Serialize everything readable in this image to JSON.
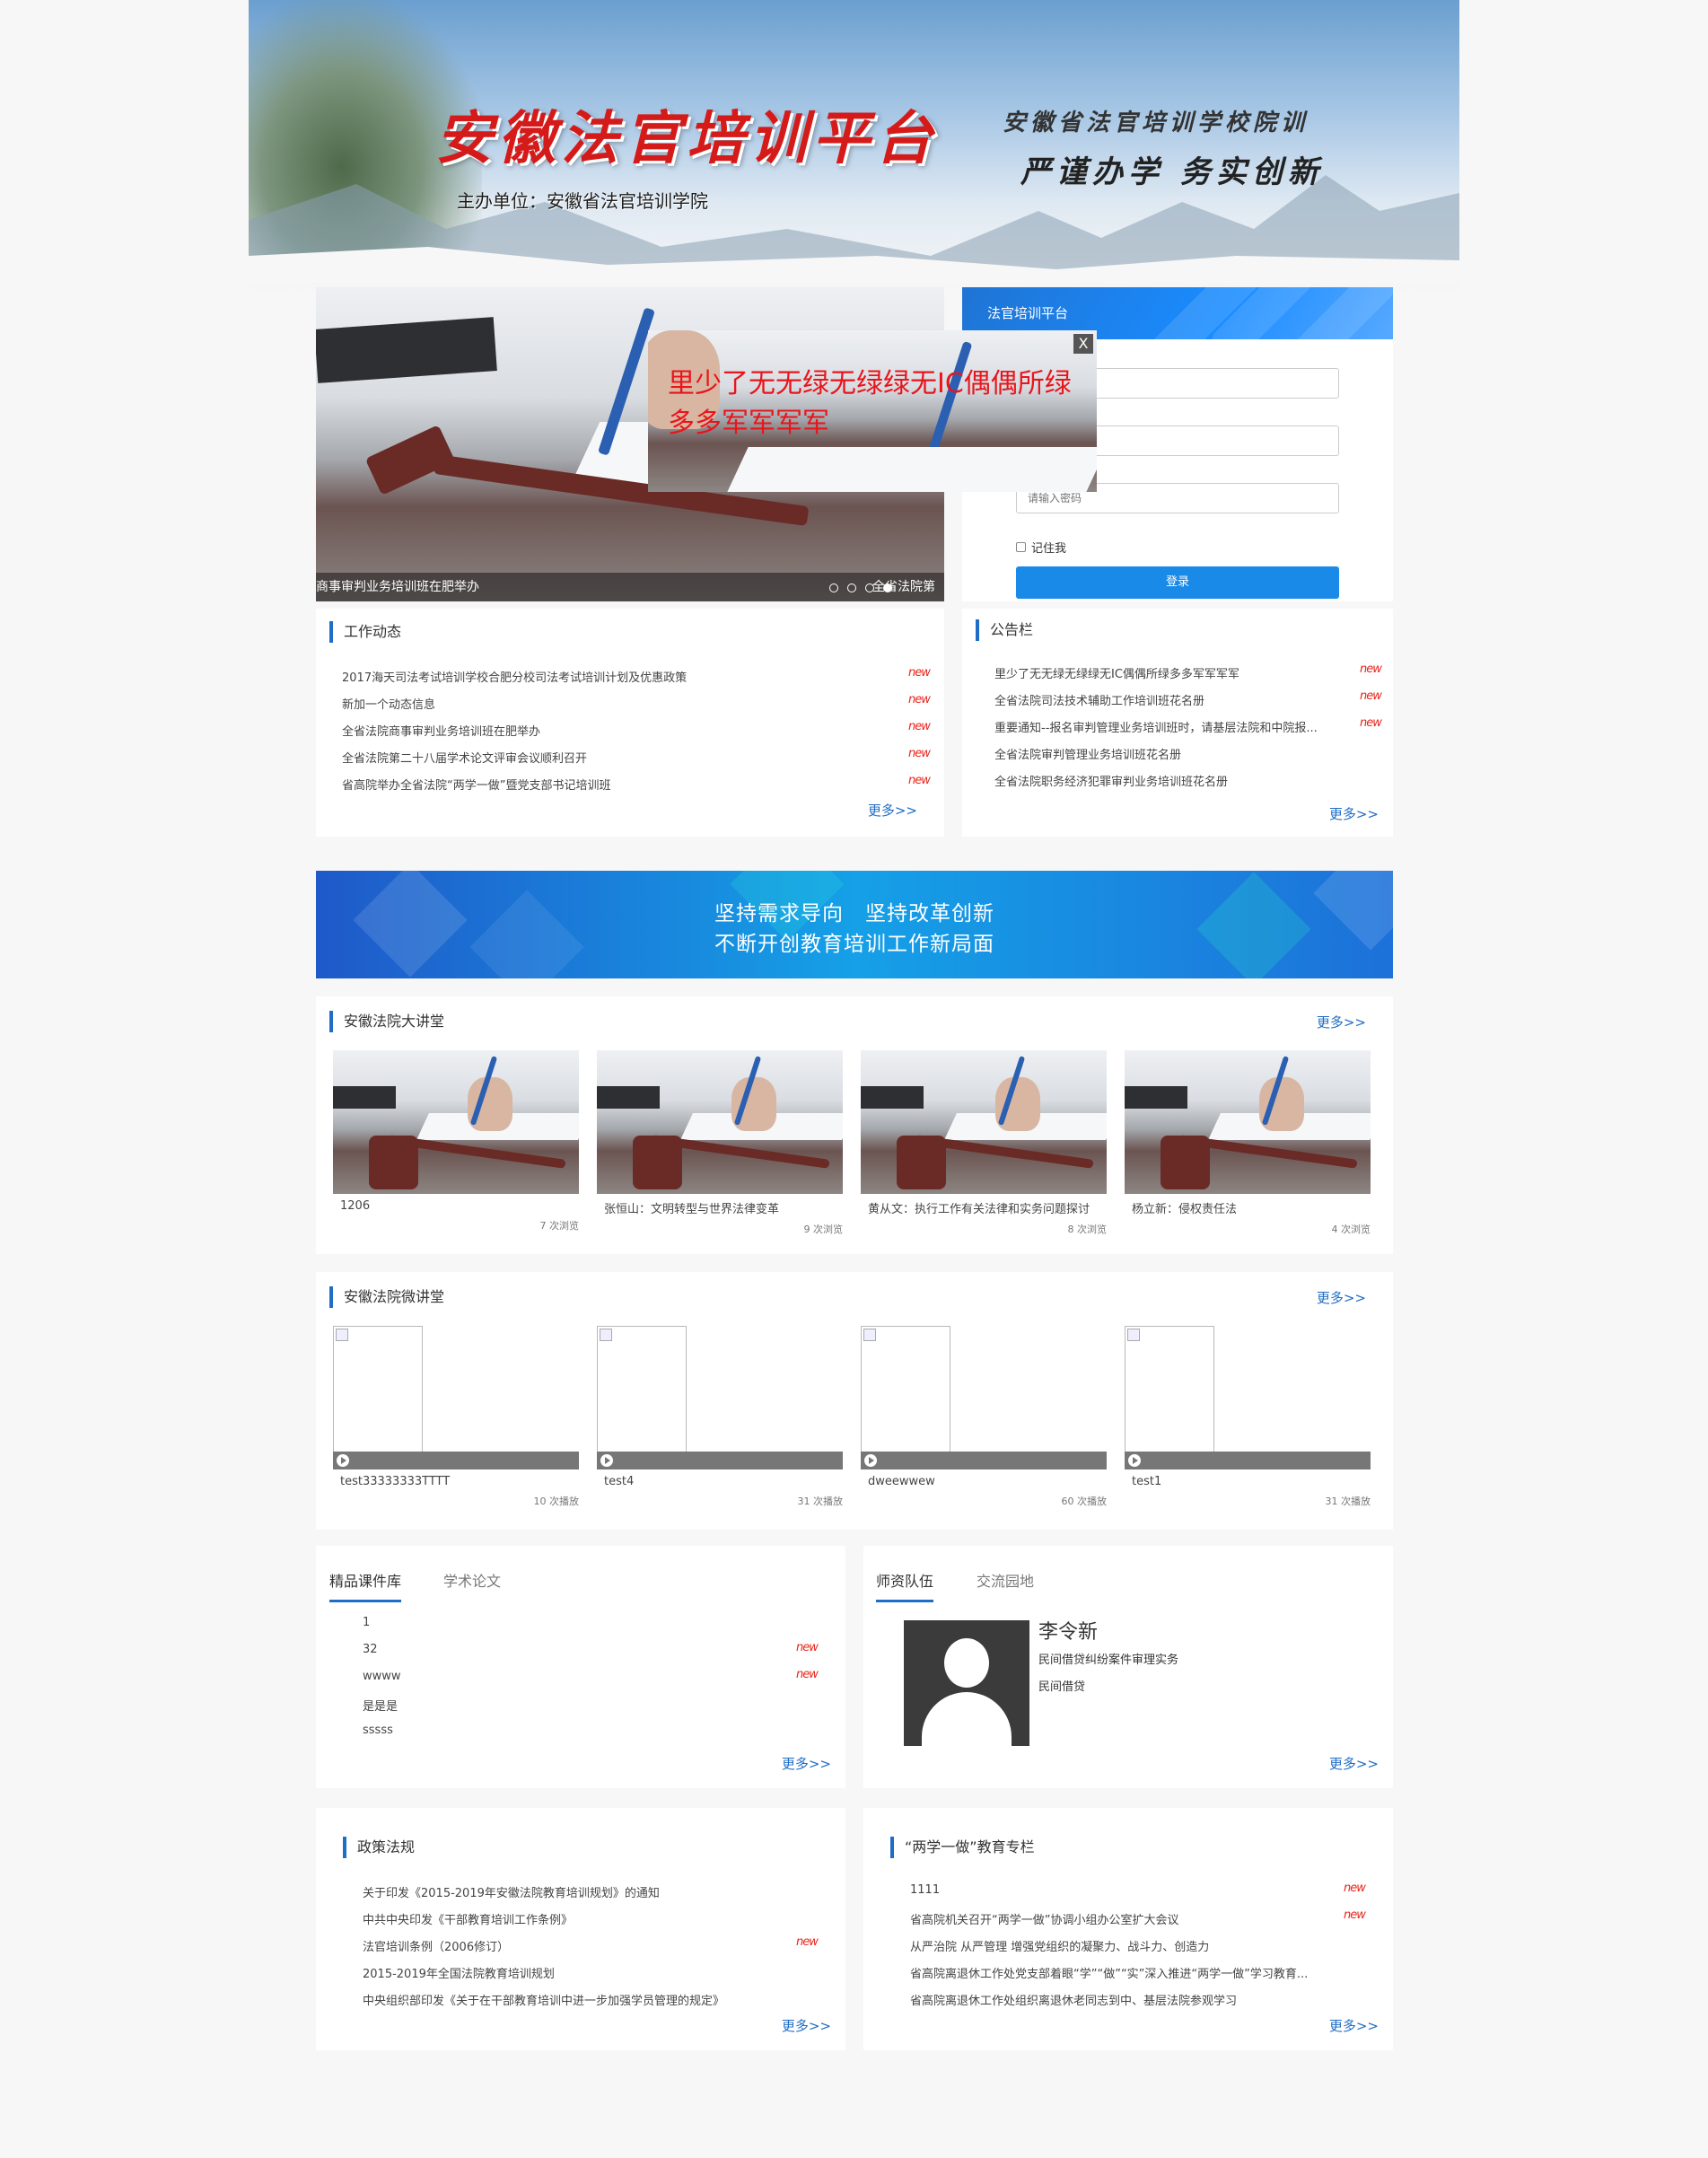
{
  "header": {
    "site_title": "安徽法官培训平台",
    "sponsor": "主办单位：安徽省法官培训学院",
    "slogan_line1": "安徽省法官培训学校院训",
    "slogan_line2": "严谨办学 务实创新"
  },
  "slider": {
    "caption": "商事审判业务培训班在肥举办",
    "caption_right": "全省法院第",
    "dots": 4
  },
  "popup": {
    "text": "里少了无无绿无绿绿无IC偶偶所绿多多军军军军",
    "close_label": "X"
  },
  "login": {
    "title": "法官培训平台",
    "username_placeholder": "",
    "password_placeholder_partial": "码",
    "password_placeholder": "请输入密码",
    "remember_label": "记住我",
    "login_button": "登录"
  },
  "work_news": {
    "title": "工作动态",
    "items": [
      {
        "text": "2017海天司法考试培训学校合肥分校司法考试培训计划及优惠政策",
        "new": true
      },
      {
        "text": "新加一个动态信息",
        "new": true
      },
      {
        "text": "全省法院商事审判业务培训班在肥举办",
        "new": true
      },
      {
        "text": "全省法院第二十八届学术论文评审会议顺利召开",
        "new": true
      },
      {
        "text": "省高院举办全省法院“两学一做”暨党支部书记培训班",
        "new": true
      }
    ],
    "more": "更多>>"
  },
  "notice": {
    "title": "公告栏",
    "items": [
      {
        "text": "里少了无无绿无绿绿无IC偶偶所绿多多军军军军",
        "new": true
      },
      {
        "text": "全省法院司法技术辅助工作培训班花名册",
        "new": true
      },
      {
        "text": "重要通知--报名审判管理业务培训班时，请基层法院和中院报...",
        "new": true
      },
      {
        "text": "全省法院审判管理业务培训班花名册",
        "new": false
      },
      {
        "text": "全省法院职务经济犯罪审判业务培训班花名册",
        "new": false
      }
    ],
    "more": "更多>>"
  },
  "new_label": "new",
  "banner": {
    "line1": "坚持需求导向　坚持改革创新",
    "line2": "不断开创教育培训工作新局面"
  },
  "lecture_hall": {
    "title": "安徽法院大讲堂",
    "more": "更多>>",
    "items": [
      {
        "title": "1206",
        "views": "7 次浏览"
      },
      {
        "title": "张恒山：文明转型与世界法律变革",
        "views": "9 次浏览"
      },
      {
        "title": "黄从文：执行工作有关法律和实务问题探讨",
        "views": "8 次浏览"
      },
      {
        "title": "杨立新：侵权责任法",
        "views": "4 次浏览"
      }
    ]
  },
  "micro_lecture": {
    "title": "安徽法院微讲堂",
    "more": "更多>>",
    "items": [
      {
        "title": "test33333333TTTT",
        "plays": "10 次播放"
      },
      {
        "title": "test4",
        "plays": "31 次播放"
      },
      {
        "title": "dweewwew",
        "plays": "60 次播放"
      },
      {
        "title": "test1",
        "plays": "31 次播放"
      }
    ]
  },
  "courseware": {
    "tabs": [
      "精品课件库",
      "学术论文"
    ],
    "items": [
      {
        "text": "1",
        "new": false
      },
      {
        "text": "32",
        "new": true
      },
      {
        "text": "wwww",
        "new": true
      },
      {
        "text": "是是是",
        "new": false
      },
      {
        "text": "sssss",
        "new": false
      }
    ],
    "more": "更多>>"
  },
  "faculty": {
    "tabs": [
      "师资队伍",
      "交流园地"
    ],
    "teacher_name": "李令新",
    "teacher_line1": "民间借贷纠纷案件审理实务",
    "teacher_line2": "民间借贷",
    "more": "更多>>"
  },
  "policy": {
    "title": "政策法规",
    "items": [
      {
        "text": "关于印发《2015-2019年安徽法院教育培训规划》的通知",
        "new": false
      },
      {
        "text": "中共中央印发《干部教育培训工作条例》",
        "new": false
      },
      {
        "text": "法官培训条例（2006修订）",
        "new": true
      },
      {
        "text": "2015-2019年全国法院教育培训规划",
        "new": false
      },
      {
        "text": "中央组织部印发《关于在干部教育培训中进一步加强学员管理的规定》",
        "new": false
      }
    ],
    "more": "更多>>"
  },
  "two_study": {
    "title": "“两学一做”教育专栏",
    "items": [
      {
        "text": "1111",
        "new": true
      },
      {
        "text": "省高院机关召开“两学一做”协调小组办公室扩大会议",
        "new": true
      },
      {
        "text": "从严治院 从严管理 增强党组织的凝聚力、战斗力、创造力",
        "new": false
      },
      {
        "text": "省高院离退休工作处党支部着眼“学”“做”“实”深入推进“两学一做”学习教育...",
        "new": false
      },
      {
        "text": "省高院离退休工作处组织离退休老同志到中、基层法院参观学习",
        "new": false
      }
    ],
    "more": "更多>>"
  }
}
